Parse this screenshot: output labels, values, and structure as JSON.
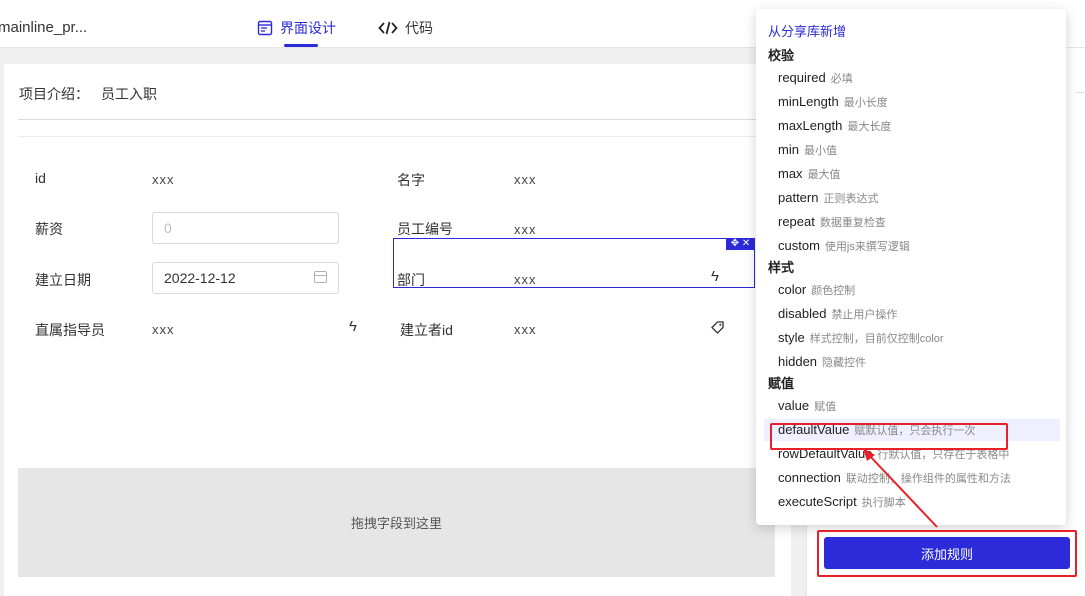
{
  "header": {
    "project_name": "mainline_pr...",
    "tabs": [
      {
        "label": "界面设计",
        "active": true
      },
      {
        "label": "代码",
        "active": false
      }
    ]
  },
  "form": {
    "intro_label": "项目介绍：",
    "intro_value": "员工入职",
    "fields": {
      "id": {
        "label": "id",
        "value": "xxx"
      },
      "name": {
        "label": "名字",
        "value": "xxx"
      },
      "salary": {
        "label": "薪资",
        "placeholder": "0"
      },
      "employee_no": {
        "label": "员工编号",
        "value": "xxx"
      },
      "created_date": {
        "label": "建立日期",
        "value": "2022-12-12"
      },
      "department": {
        "label": "部门",
        "value": "xxx"
      },
      "supervisor": {
        "label": "直属指导员",
        "value": "xxx"
      },
      "creator_id": {
        "label": "建立者id",
        "value": "xxx"
      }
    },
    "drop_zone": "拖拽字段到这里"
  },
  "rule_menu": {
    "from_library": "从分享库新增",
    "groups": [
      {
        "title": "校验",
        "items": [
          {
            "name": "required",
            "desc": "必填"
          },
          {
            "name": "minLength",
            "desc": "最小长度"
          },
          {
            "name": "maxLength",
            "desc": "最大长度"
          },
          {
            "name": "min",
            "desc": "最小值"
          },
          {
            "name": "max",
            "desc": "最大值"
          },
          {
            "name": "pattern",
            "desc": "正则表达式"
          },
          {
            "name": "repeat",
            "desc": "数据重复检查"
          },
          {
            "name": "custom",
            "desc": "使用js来撰写逻辑"
          }
        ]
      },
      {
        "title": "样式",
        "items": [
          {
            "name": "color",
            "desc": "颜色控制"
          },
          {
            "name": "disabled",
            "desc": "禁止用户操作"
          },
          {
            "name": "style",
            "desc": "样式控制，目前仅控制color"
          },
          {
            "name": "hidden",
            "desc": "隐藏控件"
          }
        ]
      },
      {
        "title": "赋值",
        "items": [
          {
            "name": "value",
            "desc": "赋值"
          },
          {
            "name": "defaultValue",
            "desc": "赋默认值，只会执行一次"
          },
          {
            "name": "rowDefaultValue",
            "desc": "行默认值，只存在于表格中"
          },
          {
            "name": "connection",
            "desc": "联动控制，操作组件的属性和方法"
          },
          {
            "name": "executeScript",
            "desc": "执行脚本"
          }
        ]
      }
    ],
    "highlighted_item": "defaultValue"
  },
  "add_rule_button": "添加规则",
  "colors": {
    "accent": "#2b2bd9",
    "annotation": "#e8202a"
  }
}
